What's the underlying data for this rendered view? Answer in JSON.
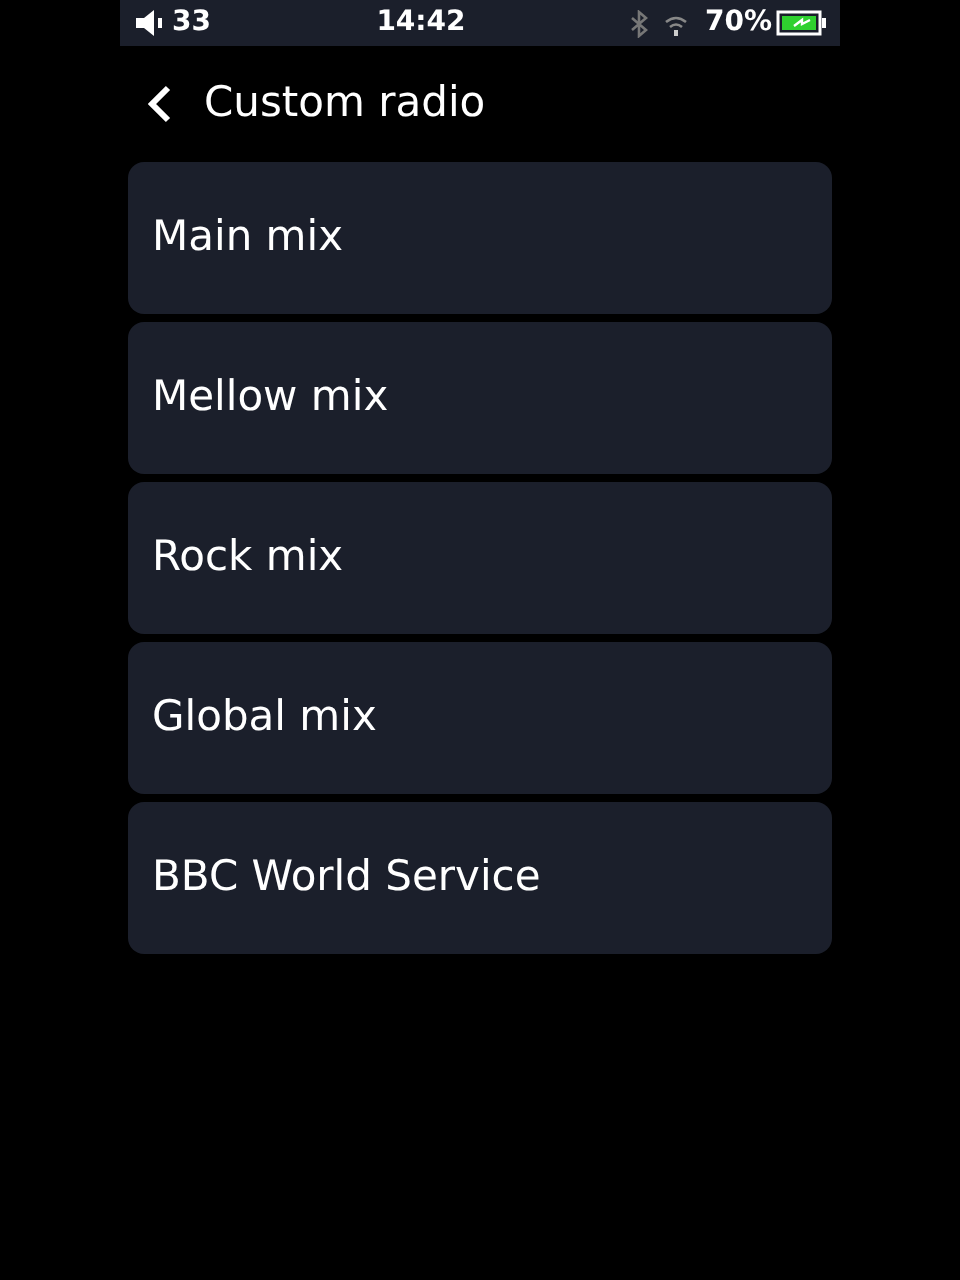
{
  "status_bar": {
    "volume": "33",
    "time": "14:42",
    "battery": "70%"
  },
  "header": {
    "title": "Custom radio"
  },
  "items": [
    {
      "label": "Main mix"
    },
    {
      "label": "Mellow mix"
    },
    {
      "label": "Rock mix"
    },
    {
      "label": "Global mix"
    },
    {
      "label": "BBC World Service"
    }
  ]
}
